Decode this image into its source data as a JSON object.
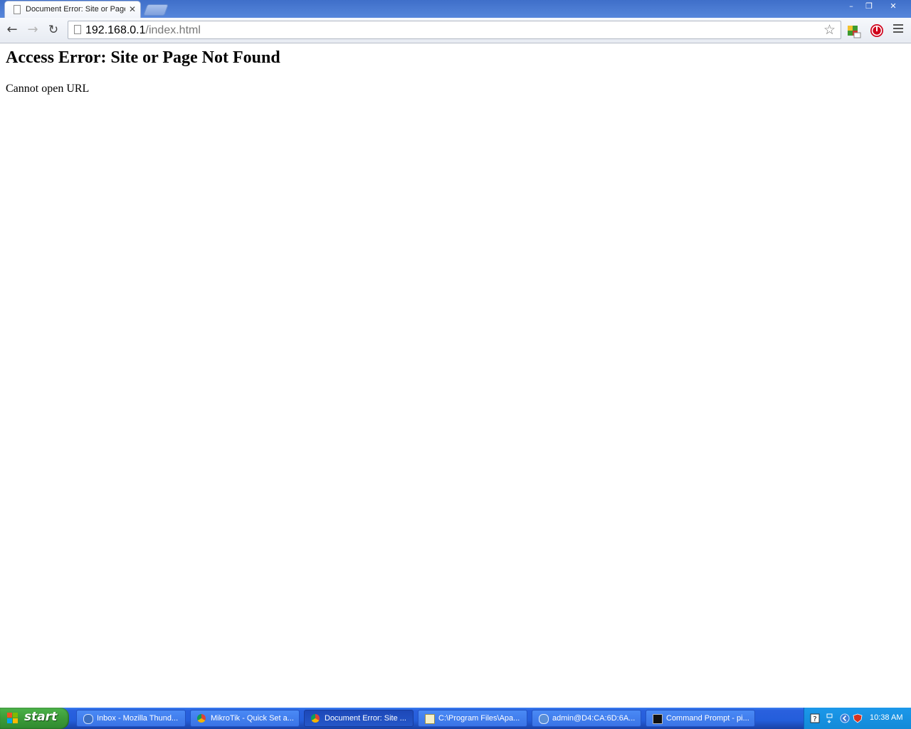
{
  "browser": {
    "tab": {
      "title": "Document Error: Site or Page Not Found",
      "close_glyph": "✕"
    },
    "window_controls": {
      "minimize": "–",
      "maximize": "❐",
      "close": "✕"
    },
    "toolbar": {
      "back_glyph": "←",
      "forward_glyph": "→",
      "reload_glyph": "↻",
      "url_host": "192.168.0.1",
      "url_path": "/index.html",
      "star_glyph": "☆"
    }
  },
  "page": {
    "heading": "Access Error: Site or Page Not Found",
    "message": "Cannot open URL"
  },
  "taskbar": {
    "start_label": "start",
    "items": [
      {
        "label": "Inbox - Mozilla Thund...",
        "icon": "thunderbird-icon",
        "active": false
      },
      {
        "label": "MikroTik - Quick Set a...",
        "icon": "chrome-icon",
        "active": false
      },
      {
        "label": "Document Error: Site ...",
        "icon": "chrome-icon",
        "active": true
      },
      {
        "label": "C:\\Program Files\\Apa...",
        "icon": "notepad-icon",
        "active": false
      },
      {
        "label": "admin@D4:CA:6D:6A...",
        "icon": "winbox-icon",
        "active": false
      },
      {
        "label": "Command Prompt - pi...",
        "icon": "cmd-icon",
        "active": false
      }
    ],
    "clock": "10:38 AM"
  }
}
